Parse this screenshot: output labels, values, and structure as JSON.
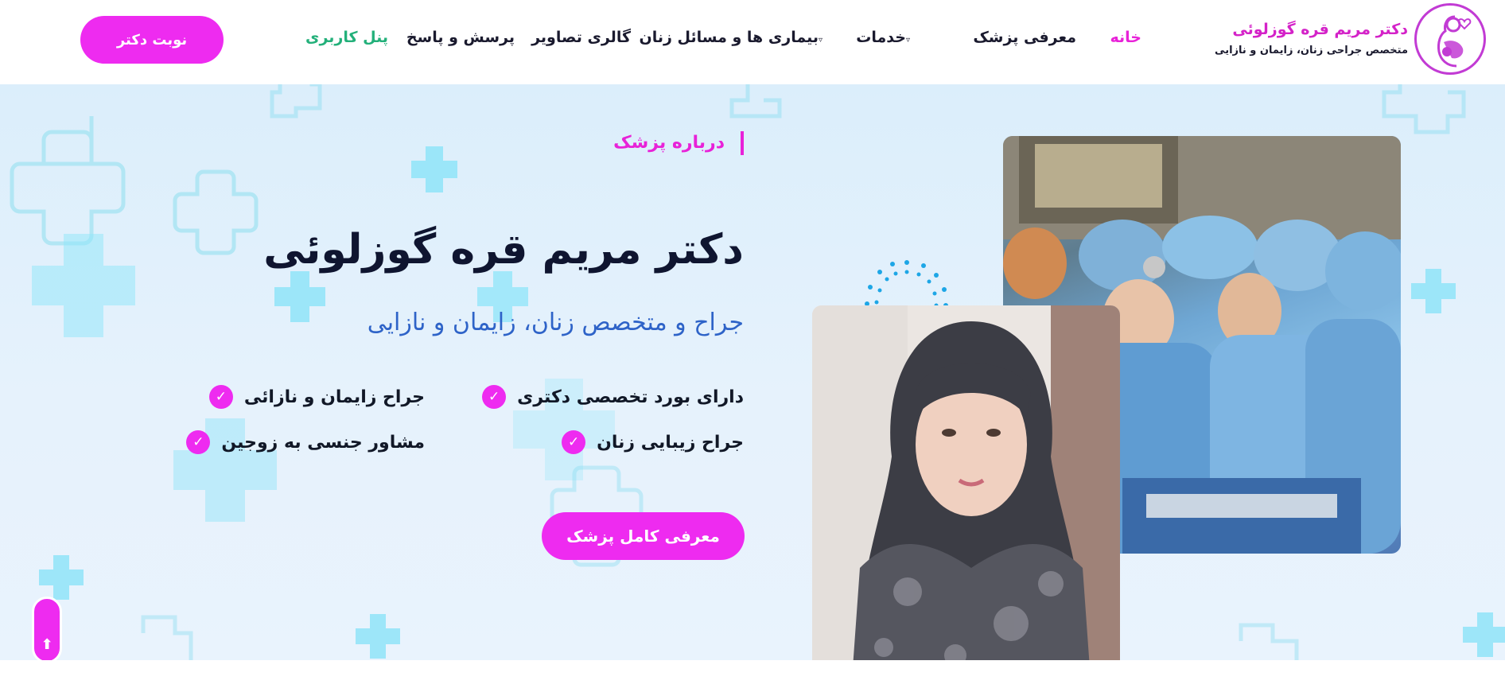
{
  "brand": {
    "title": "دکتر مریم قره گوزلوئی",
    "subtitle": "متخصص جراحی زنان، زایمان و نازایی",
    "logo_icon": "mother-baby-icon",
    "accent_color": "#ee2bf0"
  },
  "nav": {
    "items": [
      {
        "label": "خانه",
        "state": "active"
      },
      {
        "label": "معرفی پزشک"
      },
      {
        "label": "خدمات",
        "has_dropdown": true
      },
      {
        "label": "بیماری ها و مسائل زنان",
        "has_dropdown": true
      },
      {
        "label": "گالری تصاویر"
      },
      {
        "label": "پرسش و پاسخ"
      },
      {
        "label": "پنل کاربری",
        "state": "highlight"
      }
    ],
    "caret": "▿",
    "cta_label": "نوبت دکتر"
  },
  "hero": {
    "tag": "درباره پزشک",
    "name": "دکتر مریم قره گوزلوئی",
    "subtitle": "جراح و متخصص زنان، زایمان و نازایی",
    "features": [
      "دارای بورد تخصصی دکتری",
      "جراح زایمان و نازائی",
      "جراح زیبایی زنان",
      "مشاور جنسی به زوجین"
    ],
    "check_icon": "check-icon",
    "check_glyph": "✓",
    "button_label": "معرفی کامل پزشک",
    "surgery_image": "surgery-team-photo",
    "portrait_image": "doctor-portrait-photo",
    "scroll_glyph": "⬆"
  }
}
